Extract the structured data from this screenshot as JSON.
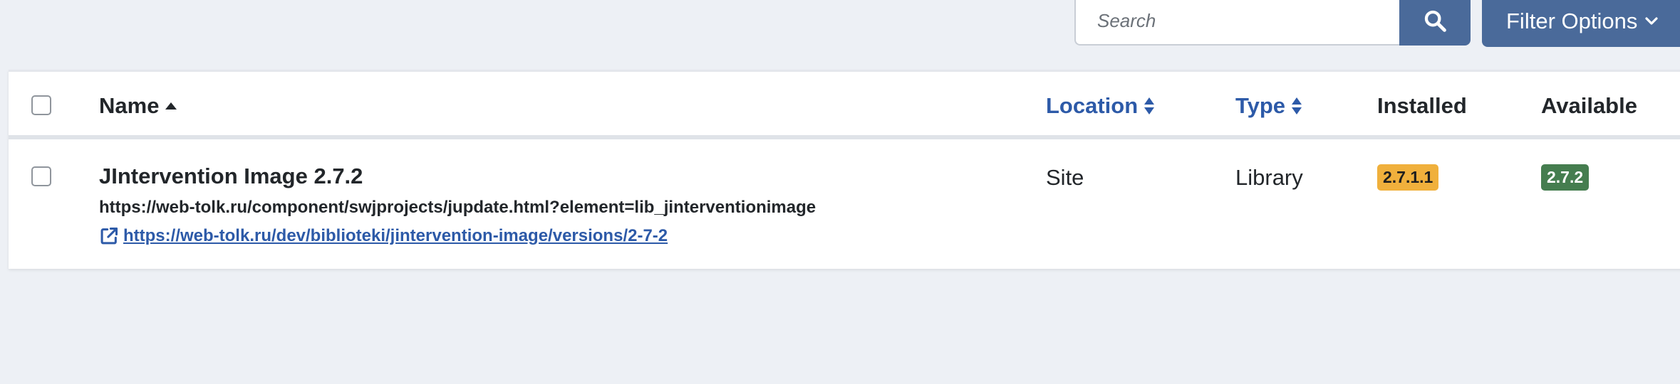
{
  "toolbar": {
    "search_placeholder": "Search",
    "filter_label": "Filter Options"
  },
  "table": {
    "columns": {
      "name": "Name",
      "location": "Location",
      "type": "Type",
      "installed": "Installed",
      "available": "Available"
    },
    "rows": [
      {
        "name": "JIntervention Image 2.7.2",
        "update_url": "https://web-tolk.ru/component/swjprojects/jupdate.html?element=lib_jinterventionimage",
        "info_url": "https://web-tolk.ru/dev/biblioteki/jintervention-image/versions/2-7-2",
        "location": "Site",
        "type": "Library",
        "installed": "2.7.1.1",
        "available": "2.7.2"
      }
    ]
  },
  "colors": {
    "page_bg": "#edf0f5",
    "primary_button": "#4a6a9a",
    "link": "#2d5aa8",
    "installed_badge": "#f0b03c",
    "available_badge": "#457d4f"
  },
  "icons": {
    "search": "search-icon",
    "filter_chevron": "chevron-down-icon",
    "sort_asc": "caret-up-icon",
    "sort_both": "sort-icon",
    "external_link": "external-link-icon"
  }
}
